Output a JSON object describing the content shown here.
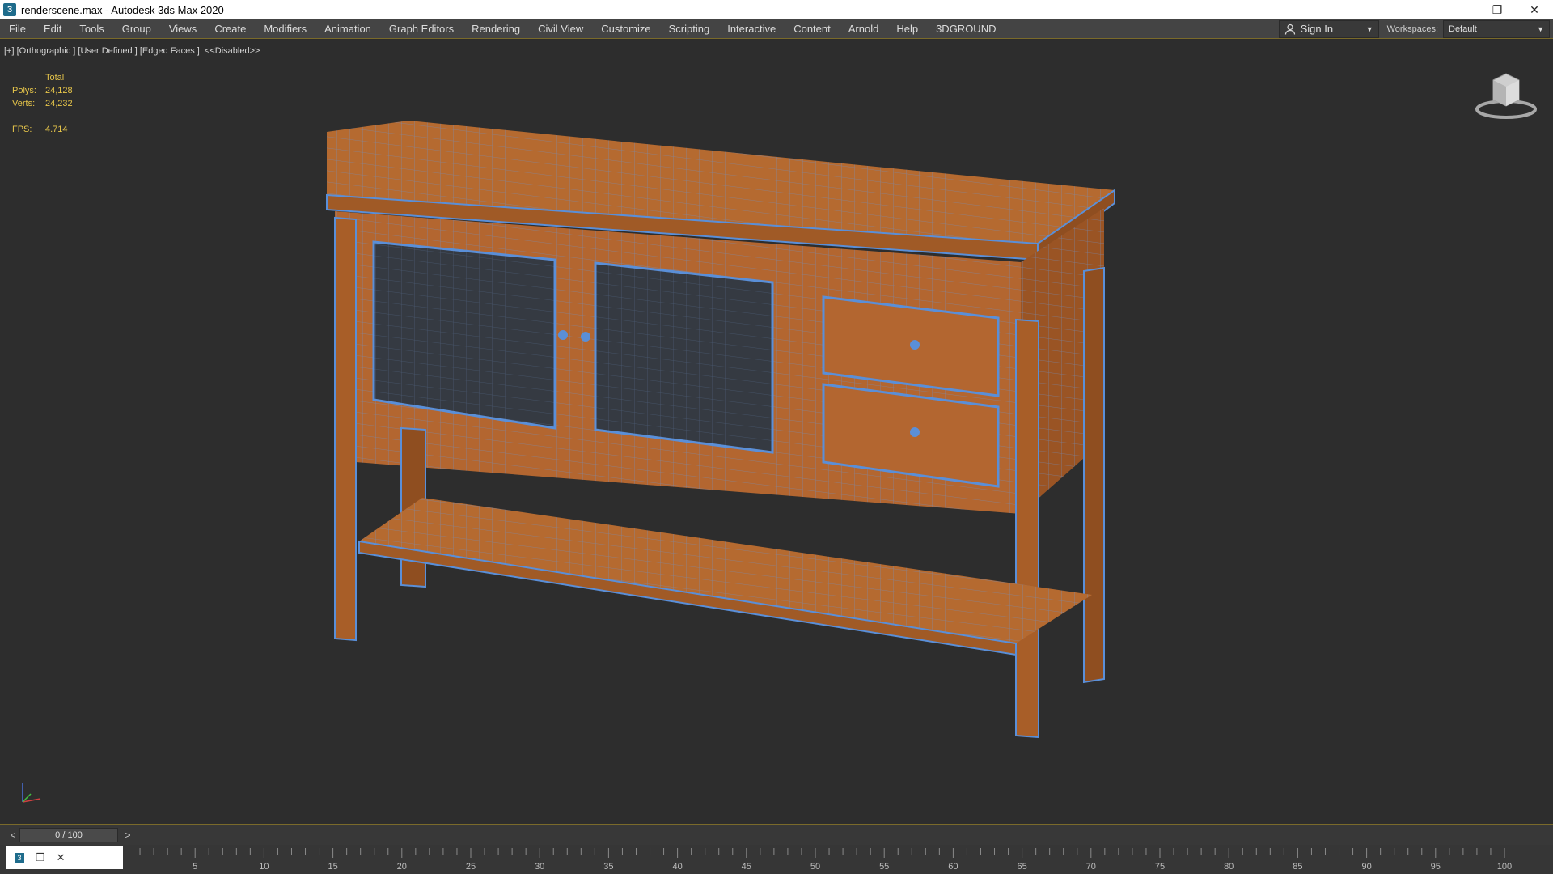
{
  "window": {
    "title": "renderscene.max - Autodesk 3ds Max 2020",
    "app_icon": "3ds-max-icon",
    "controls": [
      "minimize",
      "restore",
      "close"
    ]
  },
  "menu": {
    "items": [
      "File",
      "Edit",
      "Tools",
      "Group",
      "Views",
      "Create",
      "Modifiers",
      "Animation",
      "Graph Editors",
      "Rendering",
      "Civil View",
      "Customize",
      "Scripting",
      "Interactive",
      "Content",
      "Arnold",
      "Help",
      "3DGROUND"
    ],
    "sign_in": "Sign In",
    "workspaces_label": "Workspaces:",
    "workspace_value": "Default"
  },
  "viewport": {
    "label": "[+] [Orthographic ] [User Defined ] [Edged Faces ]  <<Disabled>>",
    "stats": {
      "header": "Total",
      "polys_label": "Polys:",
      "polys_value": "24,128",
      "verts_label": "Verts:",
      "verts_value": "24,232",
      "fps_label": "FPS:",
      "fps_value": "4.714"
    },
    "model": {
      "name": "sideboard-console-table",
      "wood_color": "#b8682e",
      "wood_dark": "#8f4e20",
      "wire_color": "#5a8fd8"
    }
  },
  "timeline": {
    "prev": "<",
    "next": ">",
    "slider": "0 / 100",
    "ruler_labels": [
      "5",
      "10",
      "15",
      "20",
      "25",
      "30",
      "35",
      "40",
      "45",
      "50",
      "55",
      "60",
      "65",
      "70",
      "75",
      "80",
      "85",
      "90",
      "95",
      "100"
    ]
  },
  "colors": {
    "accent_line": "#7a6a2a",
    "stats_text": "#e6c54a"
  }
}
